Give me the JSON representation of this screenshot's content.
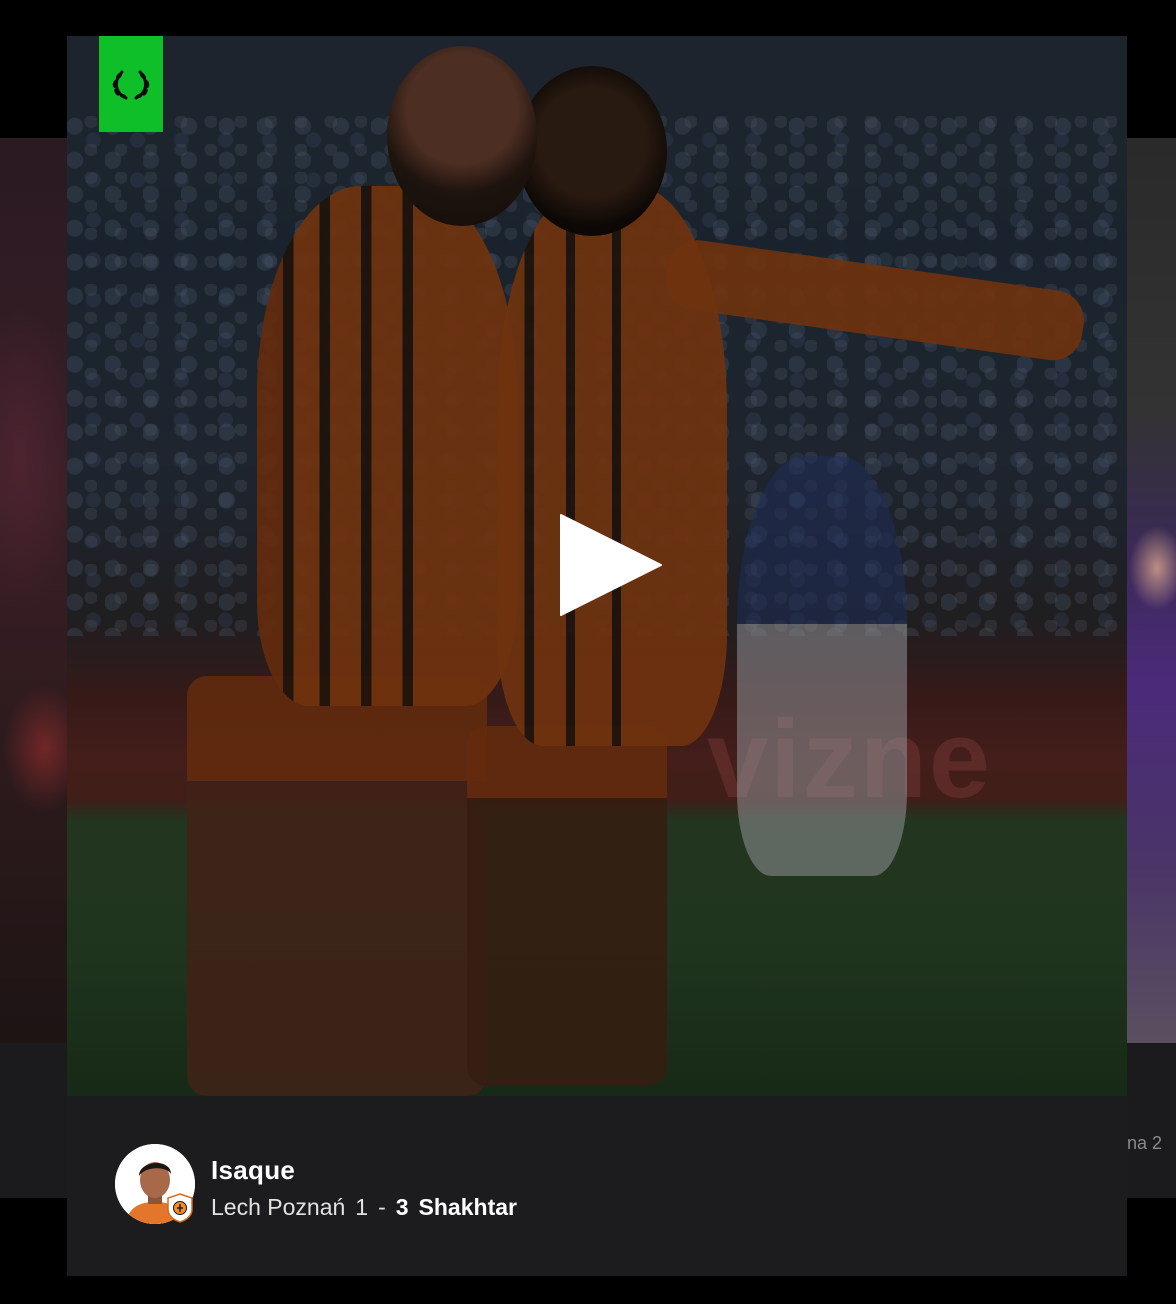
{
  "carousel": {
    "right_peek_text": "na 2"
  },
  "clip": {
    "badge_icon": "laurel-wreath-icon",
    "badge_color": "#0fbf2a",
    "play_icon": "play-icon",
    "banner_text": "vizne"
  },
  "player": {
    "name": "Isaque",
    "avatar_icon": "player-avatar",
    "club_logo_icon": "shakhtar-crest-icon"
  },
  "match": {
    "home_team": "Lech Poznań",
    "home_score": "1",
    "separator": "-",
    "away_score": "3",
    "away_team": "Shakhtar"
  }
}
